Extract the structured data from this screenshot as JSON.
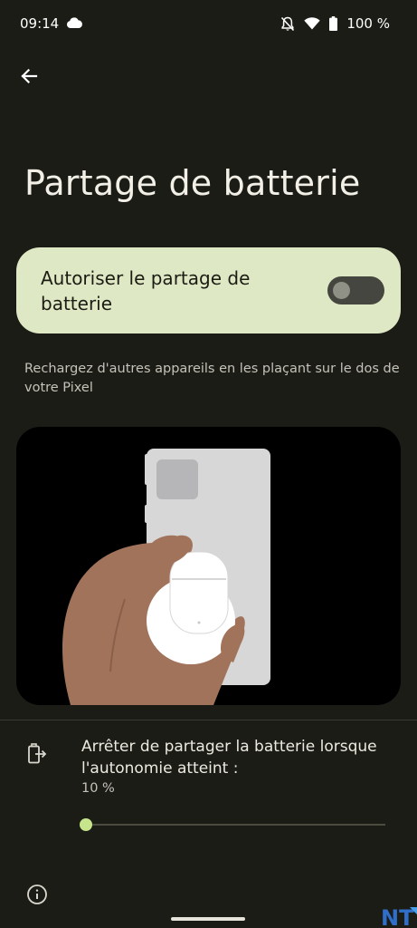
{
  "status_bar": {
    "time": "09:14",
    "battery_percent": "100 %",
    "icons": [
      "cloud-icon",
      "notifications-off-icon",
      "wifi-icon",
      "battery-icon"
    ]
  },
  "header": {
    "back_icon": "arrow-back-icon",
    "title": "Partage de batterie"
  },
  "main_toggle": {
    "label": "Autoriser le partage de batterie",
    "enabled": false
  },
  "description": "Rechargez d'autres appareils en les plaçant sur le dos de votre Pixel",
  "illustration": {
    "name": "hand-placing-earbuds-case-on-phone-back"
  },
  "stop_sharing": {
    "icon": "battery-share-icon",
    "title": "Arrêter de partager la batterie lorsque l'autonomie atteint :",
    "value_text": "10 %",
    "slider_fraction": 0.0
  },
  "footer": {
    "info_icon": "info-icon",
    "watermark_text": "NT"
  },
  "colors": {
    "background": "#1c1c17",
    "card": "#dfe8c4",
    "accent": "#c6e48c"
  }
}
